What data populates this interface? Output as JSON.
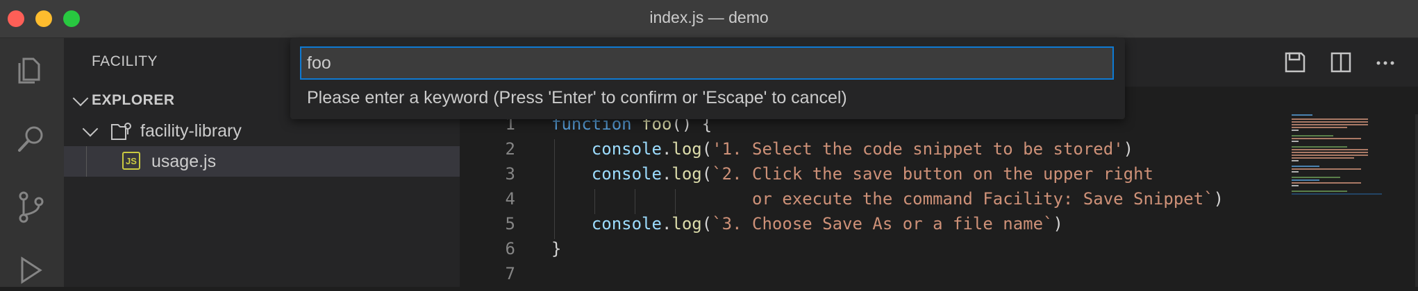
{
  "window": {
    "title": "index.js — demo"
  },
  "sidebar": {
    "title": "FACILITY",
    "section": "EXPLORER",
    "folder": "facility-library",
    "file": "usage.js",
    "file_icon_text": "JS"
  },
  "quick_input": {
    "value": "foo",
    "message": "Please enter a keyword (Press 'Enter' to confirm or 'Escape' to cancel)"
  },
  "editor": {
    "lines": [
      {
        "n": "1",
        "tokens": [
          [
            "kw",
            "function "
          ],
          [
            "fn",
            "foo"
          ],
          [
            "pn",
            "() {"
          ]
        ]
      },
      {
        "n": "2",
        "tokens": [
          [
            "pn",
            "    "
          ],
          [
            "var",
            "console"
          ],
          [
            "pn",
            "."
          ],
          [
            "fn",
            "log"
          ],
          [
            "pn",
            "("
          ],
          [
            "str",
            "'1. Select the code snippet to be stored'"
          ],
          [
            "pn",
            ")"
          ]
        ]
      },
      {
        "n": "3",
        "tokens": [
          [
            "pn",
            "    "
          ],
          [
            "var",
            "console"
          ],
          [
            "pn",
            "."
          ],
          [
            "fn",
            "log"
          ],
          [
            "pn",
            "("
          ],
          [
            "str",
            "`2. Click the save button on the upper right"
          ]
        ]
      },
      {
        "n": "4",
        "tokens": [
          [
            "str",
            "                    or execute the command Facility: Save Snippet`"
          ],
          [
            "pn",
            ")"
          ]
        ]
      },
      {
        "n": "5",
        "tokens": [
          [
            "pn",
            "    "
          ],
          [
            "var",
            "console"
          ],
          [
            "pn",
            "."
          ],
          [
            "fn",
            "log"
          ],
          [
            "pn",
            "("
          ],
          [
            "str",
            "`3. Choose Save As or a file name`"
          ],
          [
            "pn",
            ")"
          ]
        ]
      },
      {
        "n": "6",
        "tokens": [
          [
            "pn",
            "}"
          ]
        ]
      },
      {
        "n": "7",
        "tokens": []
      }
    ]
  },
  "colors": {
    "accent": "#0e7ad3",
    "keyword": "#569cd6",
    "function": "#dcdcaa",
    "variable": "#9cdcfe",
    "string": "#ce9178"
  },
  "icons": {
    "activity": [
      "files-icon",
      "search-icon",
      "source-control-icon",
      "run-debug-icon"
    ],
    "toolbar": [
      "save-snippet-icon",
      "split-editor-icon",
      "more-actions-icon"
    ]
  }
}
